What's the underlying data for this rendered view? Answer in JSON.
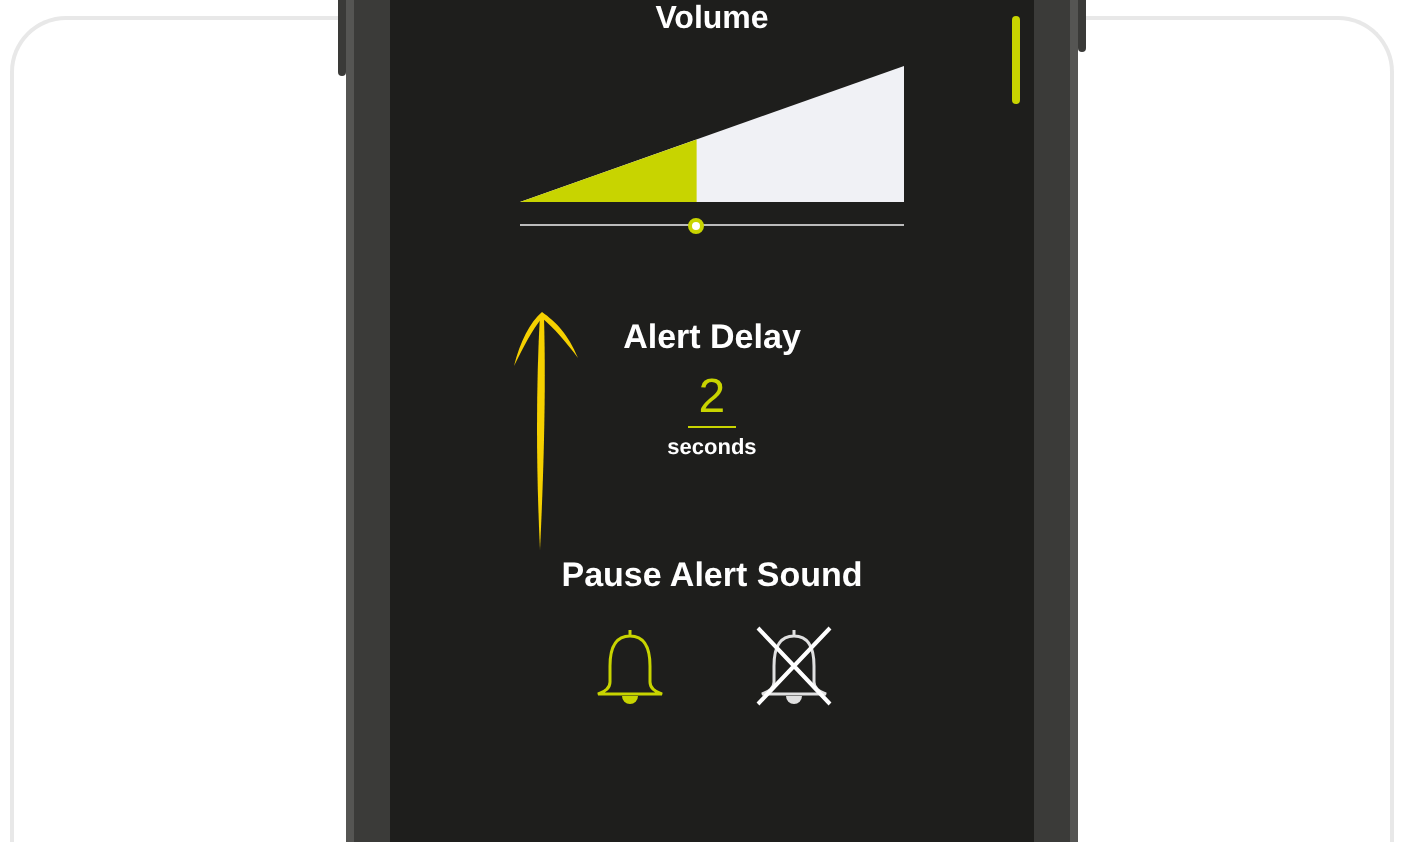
{
  "volume": {
    "title": "Volume",
    "level": 0.46
  },
  "alert_delay": {
    "title": "Alert Delay",
    "value": "2",
    "unit": "seconds"
  },
  "pause_alert_sound": {
    "title": "Pause Alert Sound",
    "options": [
      {
        "kind": "sound_on",
        "selected": true
      },
      {
        "kind": "sound_off",
        "selected": false
      }
    ]
  }
}
